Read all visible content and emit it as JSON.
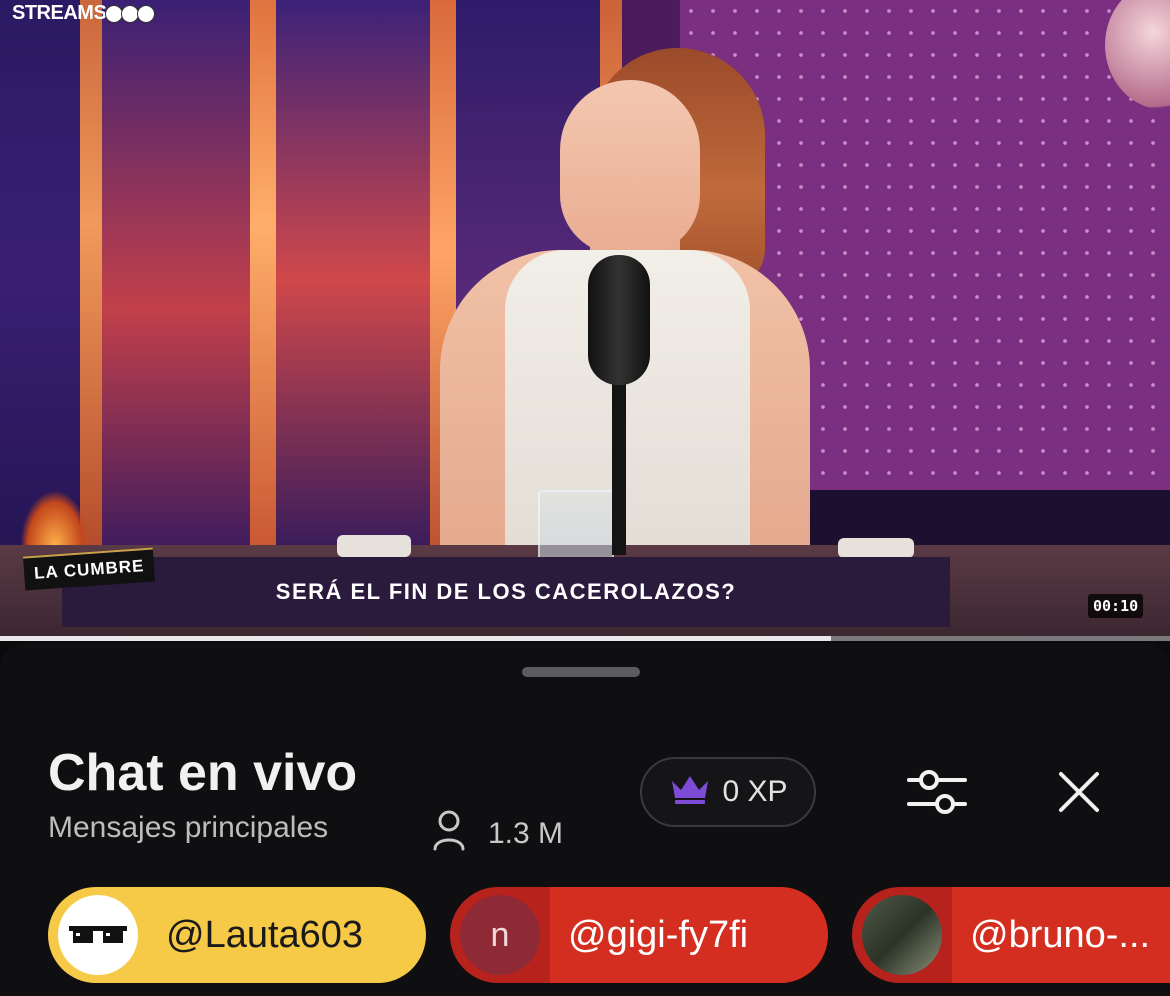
{
  "video": {
    "brand": "STREAMS",
    "show_tag": "LA CUMBRE",
    "headline": "SERÁ EL FIN DE LOS CACEROLAZOS?",
    "timestamp": "00:10",
    "progress_fraction": 0.71
  },
  "chat": {
    "title": "Chat en vivo",
    "mode": "Mensajes principales",
    "viewers": "1.3 M",
    "xp": "0 XP",
    "icons": {
      "viewers": "person-icon",
      "xp": "crown-icon",
      "filters": "sliders-icon",
      "close": "close-icon"
    },
    "highlight_users": [
      {
        "handle": "@Lauta603",
        "avatar_letter": "",
        "color": "#f6c947"
      },
      {
        "handle": "@gigi-fy7fi",
        "avatar_letter": "n",
        "color": "#d42e20"
      },
      {
        "handle": "@bruno-...",
        "avatar_letter": "",
        "color": "#d42e20"
      }
    ]
  },
  "colors": {
    "sheet_bg": "#0f0f11",
    "crown": "#7d4bd6"
  }
}
